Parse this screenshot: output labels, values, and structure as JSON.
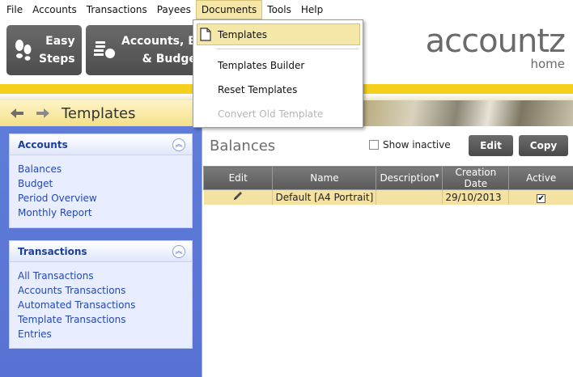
{
  "menubar": {
    "items": [
      "File",
      "Accounts",
      "Transactions",
      "Payees",
      "Documents",
      "Tools",
      "Help"
    ],
    "open_index": 4
  },
  "toolbar": {
    "easy_steps": "Easy\nSteps",
    "accounts_budgets": "Accounts, B\n& Budge"
  },
  "logo": {
    "brand": "accountz",
    "edition": "home"
  },
  "header": {
    "title": "Templates",
    "back_icon": "back-arrow-icon",
    "forward_icon": "forward-arrow-icon"
  },
  "dropdown": {
    "items": [
      {
        "label": "Templates",
        "selected": true,
        "enabled": true,
        "icon": "document-icon"
      },
      {
        "label": "Templates Builder",
        "enabled": true
      },
      {
        "label": "Reset Templates",
        "enabled": true
      },
      {
        "label": "Convert Old Template",
        "enabled": false
      }
    ]
  },
  "sidebar": {
    "accounts": {
      "title": "Accounts",
      "items": [
        "Balances",
        "Budget",
        "Period Overview",
        "Monthly Report"
      ]
    },
    "transactions": {
      "title": "Transactions",
      "items": [
        "All Transactions",
        "Accounts Transactions",
        "Automated Transactions",
        "Template Transactions",
        "Entries"
      ]
    }
  },
  "main": {
    "heading": "Balances",
    "show_inactive": "Show inactive",
    "show_inactive_checked": false,
    "edit_button": "Edit",
    "copy_button": "Copy",
    "columns": [
      "Edit",
      "Name",
      "Description",
      "Creation Date",
      "Active"
    ],
    "rows": [
      {
        "name": "Default [A4 Portrait]",
        "description": "",
        "creation_date": "29/10/2013",
        "active": true
      }
    ]
  },
  "colors": {
    "accent_yellow": "#f4cf1c",
    "sidebar_blue": "#5f7cd9",
    "link_blue": "#2347b8",
    "row_highlight": "#f3e2a2"
  }
}
